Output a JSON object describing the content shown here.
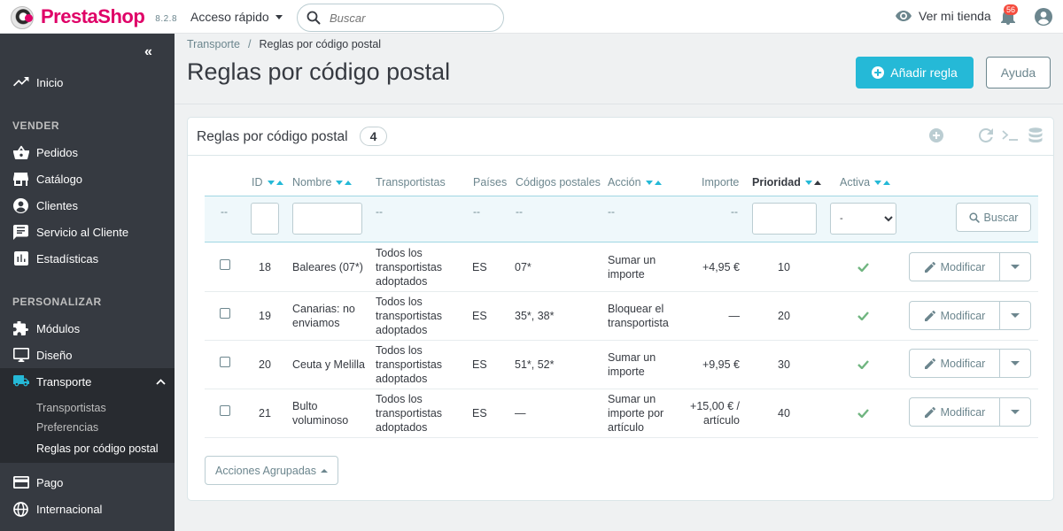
{
  "header": {
    "logo_text": "PrestaShop",
    "version": "8.2.8",
    "quick_access": "Acceso rápido",
    "search_placeholder": "Buscar",
    "view_store": "Ver mi tienda",
    "notification_count": "56"
  },
  "sidebar": {
    "home": "Inicio",
    "section_sell": "VENDER",
    "orders": "Pedidos",
    "catalog": "Catálogo",
    "customers": "Clientes",
    "customer_service": "Servicio al Cliente",
    "stats": "Estadísticas",
    "section_customize": "PERSONALIZAR",
    "modules": "Módulos",
    "design": "Diseño",
    "shipping": "Transporte",
    "sub_carriers": "Transportistas",
    "sub_preferences": "Preferencias",
    "sub_zip_rules": "Reglas por código postal",
    "payment": "Pago",
    "international": "Internacional"
  },
  "breadcrumb": {
    "parent": "Transporte",
    "separator": "/",
    "current": "Reglas por código postal"
  },
  "page": {
    "title": "Reglas por código postal",
    "add_button": "Añadir regla",
    "help_button": "Ayuda"
  },
  "panel": {
    "title": "Reglas por código postal",
    "count": "4",
    "columns": {
      "id": "ID",
      "name": "Nombre",
      "carriers": "Transportistas",
      "countries": "Países",
      "zip_codes": "Códigos postales",
      "action": "Acción",
      "amount": "Importe",
      "priority": "Prioridad",
      "active": "Activa"
    },
    "filter": {
      "dash": "--",
      "select_value": "-",
      "search_button": "Buscar"
    },
    "edit_label": "Modificar",
    "bulk_actions": "Acciones Agrupadas",
    "rows": [
      {
        "id": "18",
        "name_l1": "Baleares (07*)",
        "name_l2": "",
        "carrier_l1": "Todos los",
        "carrier_l2": "transportistas",
        "carrier_l3": "adoptados",
        "country": "ES",
        "zip": "07*",
        "action_l1": "Sumar un",
        "action_l2": "importe",
        "action_l3": "",
        "amount_l1": "+4,95 €",
        "amount_l2": "",
        "priority": "10"
      },
      {
        "id": "19",
        "name_l1": "Canarias: no",
        "name_l2": "enviamos",
        "carrier_l1": "Todos los",
        "carrier_l2": "transportistas",
        "carrier_l3": "adoptados",
        "country": "ES",
        "zip": "35*, 38*",
        "action_l1": "Bloquear el",
        "action_l2": "transportista",
        "action_l3": "",
        "amount_l1": "—",
        "amount_l2": "",
        "priority": "20"
      },
      {
        "id": "20",
        "name_l1": "Ceuta y Melilla",
        "name_l2": "",
        "carrier_l1": "Todos los",
        "carrier_l2": "transportistas",
        "carrier_l3": "adoptados",
        "country": "ES",
        "zip": "51*, 52*",
        "action_l1": "Sumar un",
        "action_l2": "importe",
        "action_l3": "",
        "amount_l1": "+9,95 €",
        "amount_l2": "",
        "priority": "30"
      },
      {
        "id": "21",
        "name_l1": "Bulto",
        "name_l2": "voluminoso",
        "carrier_l1": "Todos los",
        "carrier_l2": "transportistas",
        "carrier_l3": "adoptados",
        "country": "ES",
        "zip": "—",
        "action_l1": "Sumar un",
        "action_l2": "importe por",
        "action_l3": "artículo",
        "amount_l1": "+15,00 € /",
        "amount_l2": "artículo",
        "priority": "40"
      }
    ]
  },
  "colors": {
    "accent": "#25b9d7",
    "sidebar_bg": "#363a41",
    "brand": "#df0067",
    "success": "#70b580"
  }
}
